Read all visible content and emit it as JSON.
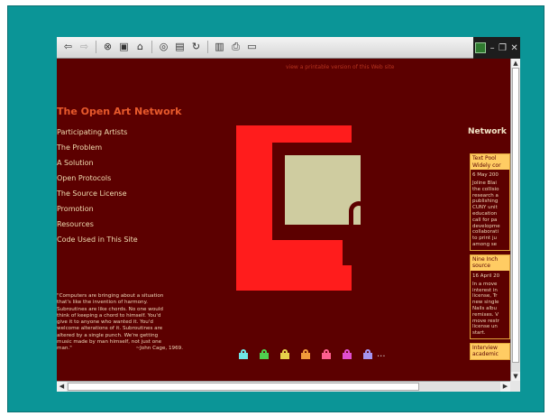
{
  "toolbar": {
    "icons": [
      "back-icon",
      "forward-icon",
      "stop-icon",
      "refresh-icon",
      "home-icon",
      "search-icon",
      "media-icon",
      "history-icon",
      "edit-icon",
      "print-icon",
      "discuss-icon"
    ]
  },
  "page": {
    "printable_link": "view a printable version of this Web site",
    "site_title": "The Open Art Network",
    "nav": [
      "Participating Artists",
      "The Problem",
      "A Solution",
      "Open Protocols",
      "The Source License",
      "Promotion",
      "Resources",
      "Code Used in This Site"
    ],
    "quote_lines": [
      "\"Computers are bringing about a situation",
      "that's like the invention of harmony.",
      "Subroutines are like chords. No one would",
      "think of keeping a chord to himself. You'd",
      "give it to anyone who wanted it. You'd",
      "welcome alterations of it. Subroutines are",
      "altered by a single punch. We're getting",
      "music made by man himself, not just one",
      "man.\""
    ],
    "quote_attr": "~John Cage, 1969.",
    "ellipsis": "...",
    "right_title": "Network",
    "news": [
      {
        "headline": [
          "Text Pool",
          "Widely cor"
        ],
        "date": "6 May 200",
        "body": [
          "Joline Blai",
          "the collisio",
          "research a",
          "publishing",
          "CUNY unit",
          "education",
          "call for pa",
          "developme",
          "collaborati",
          "to print ju",
          "among se"
        ]
      },
      {
        "headline": [
          "Nine Inch",
          "source"
        ],
        "date": "16 April 20",
        "body": [
          "In a move",
          "interest in",
          "license, Tr",
          "new single",
          "Nails albu",
          "remixes. V",
          "move restr",
          "license un",
          "start."
        ]
      },
      {
        "headline": [
          "Interview",
          "academic"
        ],
        "date": "",
        "body": []
      }
    ]
  },
  "colors": {
    "lock_colors": [
      "#6fe6e6",
      "#4fd04f",
      "#e8d04a",
      "#f29a3a",
      "#ff5f8f",
      "#e04ed0",
      "#a593f0"
    ]
  }
}
